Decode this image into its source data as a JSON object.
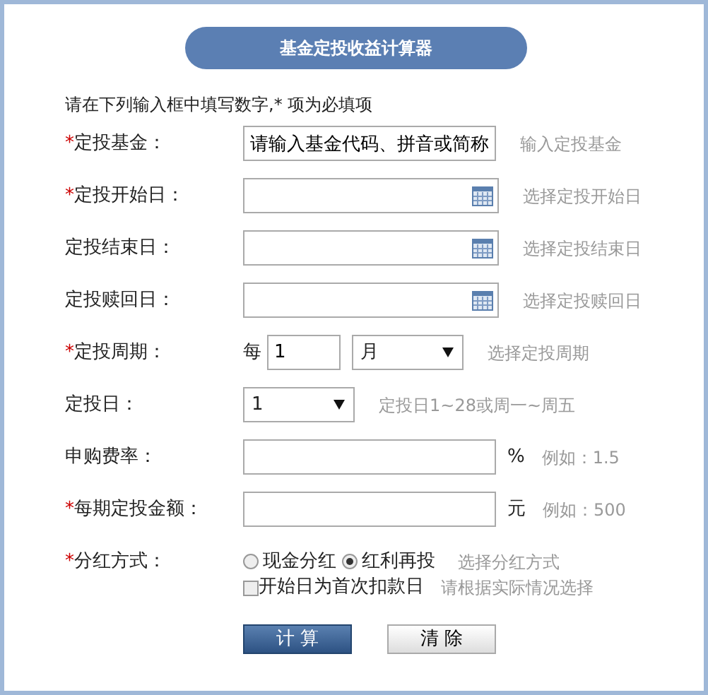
{
  "title": "基金定投收益计算器",
  "instruction": "请在下列输入框中填写数字,* 项为必填项",
  "rows": [
    {
      "kind": "text",
      "mark": "*",
      "label": "定投基金：",
      "value": "请输入基金代码、拼音或简称",
      "hint": "输入定投基金"
    },
    {
      "kind": "date",
      "mark": "*",
      "label": "定投开始日：",
      "hint": "选择定投开始日"
    },
    {
      "kind": "date",
      "label": "定投结束日：",
      "hint": "选择定投结束日"
    },
    {
      "kind": "date",
      "label": "定投赎回日：",
      "hint": "选择定投赎回日"
    },
    {
      "kind": "period",
      "mark": "*",
      "label": "定投周期：",
      "prefix": "每",
      "value": "1",
      "unit": "月",
      "hint": "选择定投周期"
    },
    {
      "kind": "select",
      "label": "定投日：",
      "value": "1",
      "hint": "定投日1~28或周一~周五"
    },
    {
      "kind": "unit",
      "label": "申购费率：",
      "suffix": "%",
      "hint": "例如：1.5"
    },
    {
      "kind": "unit",
      "mark": "*",
      "label": "每期定投金额：",
      "suffix": "元",
      "hint": "例如：500"
    },
    {
      "kind": "radio",
      "mark": "*",
      "label": "分红方式：",
      "options": [
        {
          "label": "现金分红",
          "selected": false
        },
        {
          "label": "红利再投",
          "selected": true
        }
      ],
      "hint": "选择分红方式"
    },
    {
      "kind": "checkbox",
      "label": "开始日为首次扣款日",
      "checked": false,
      "hint": "请根据实际情况选择"
    }
  ],
  "buttons": [
    {
      "label": "计 算",
      "kind": "primary"
    },
    {
      "label": "清 除",
      "kind": "secondary"
    }
  ]
}
